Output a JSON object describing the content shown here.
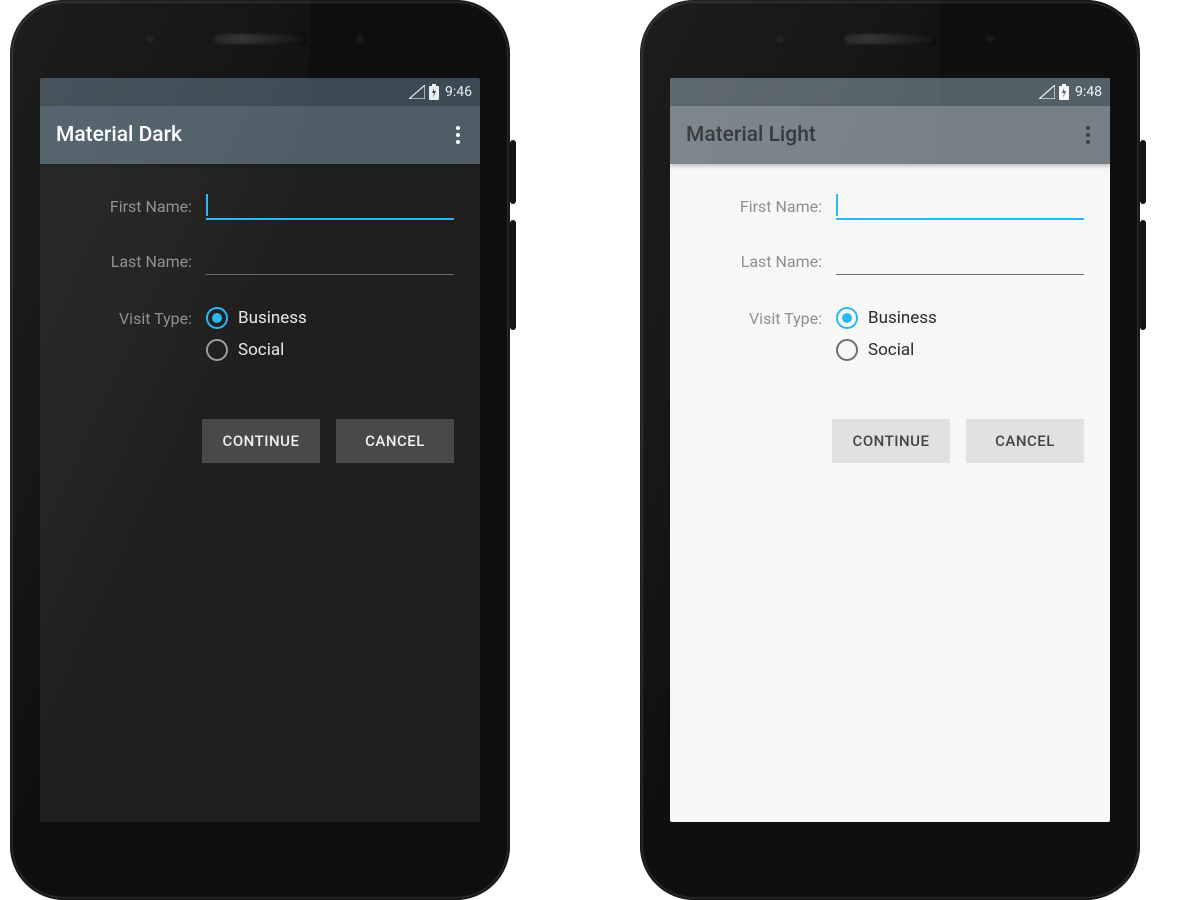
{
  "phones": {
    "dark": {
      "statusbar": {
        "time": "9:46"
      },
      "appbar": {
        "title": "Material Dark"
      },
      "form": {
        "first_name_label": "First Name:",
        "first_name_value": "",
        "last_name_label": "Last Name:",
        "last_name_value": "",
        "visit_type_label": "Visit Type:",
        "radio_business_label": "Business",
        "radio_social_label": "Social",
        "radio_selected": "business"
      },
      "buttons": {
        "continue": "CONTINUE",
        "cancel": "CANCEL"
      }
    },
    "light": {
      "statusbar": {
        "time": "9:48"
      },
      "appbar": {
        "title": "Material Light"
      },
      "form": {
        "first_name_label": "First Name:",
        "first_name_value": "",
        "last_name_label": "Last Name:",
        "last_name_value": "",
        "visit_type_label": "Visit Type:",
        "radio_business_label": "Business",
        "radio_social_label": "Social",
        "radio_selected": "business"
      },
      "buttons": {
        "continue": "CONTINUE",
        "cancel": "CANCEL"
      }
    }
  },
  "colors": {
    "accent": "#29b6f6",
    "dark_bg": "#201f1e",
    "light_bg": "#f7f7f6",
    "dark_appbar": "#4e5d66",
    "light_appbar": "#768088"
  }
}
